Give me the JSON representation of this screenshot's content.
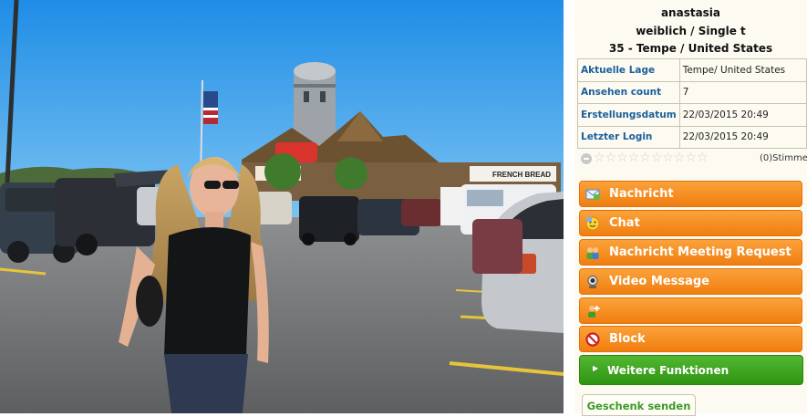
{
  "profile": {
    "name": "anastasia",
    "gender_status": "weiblich / Single t",
    "age_location": "35 - Tempe / United States"
  },
  "info_rows": [
    {
      "label": "Aktuelle Lage",
      "value": "Tempe/ United States"
    },
    {
      "label": "Ansehen count",
      "value": "7"
    },
    {
      "label": "Erstellungsdatum",
      "value": "22/03/2015 20:49"
    },
    {
      "label": "Letzter Login",
      "value": "22/03/2015 20:49"
    }
  ],
  "rating": {
    "stars_glyphs": "☆☆☆☆☆☆☆☆☆☆",
    "votes_label": "(0)Stimmen"
  },
  "actions": [
    {
      "label": "Nachricht",
      "icon": "message-icon"
    },
    {
      "label": "Chat",
      "icon": "chat-icon"
    },
    {
      "label": "Nachricht Meeting Request",
      "icon": "meeting-request-icon"
    },
    {
      "label": "Video Message",
      "icon": "webcam-icon"
    },
    {
      "label": "",
      "icon": "add-friend-icon"
    },
    {
      "label": "Block",
      "icon": "block-icon"
    }
  ],
  "more_functions": "Weitere Funktionen",
  "gift_tab": "Geschenk senden",
  "photo_signs": {
    "market_sign": "FRENCH BREAD",
    "flag_sign": "PLAY HERE!"
  },
  "colors": {
    "action_orange": "#f5901f",
    "more_green": "#3da21e",
    "label_blue": "#1a5f9a"
  }
}
